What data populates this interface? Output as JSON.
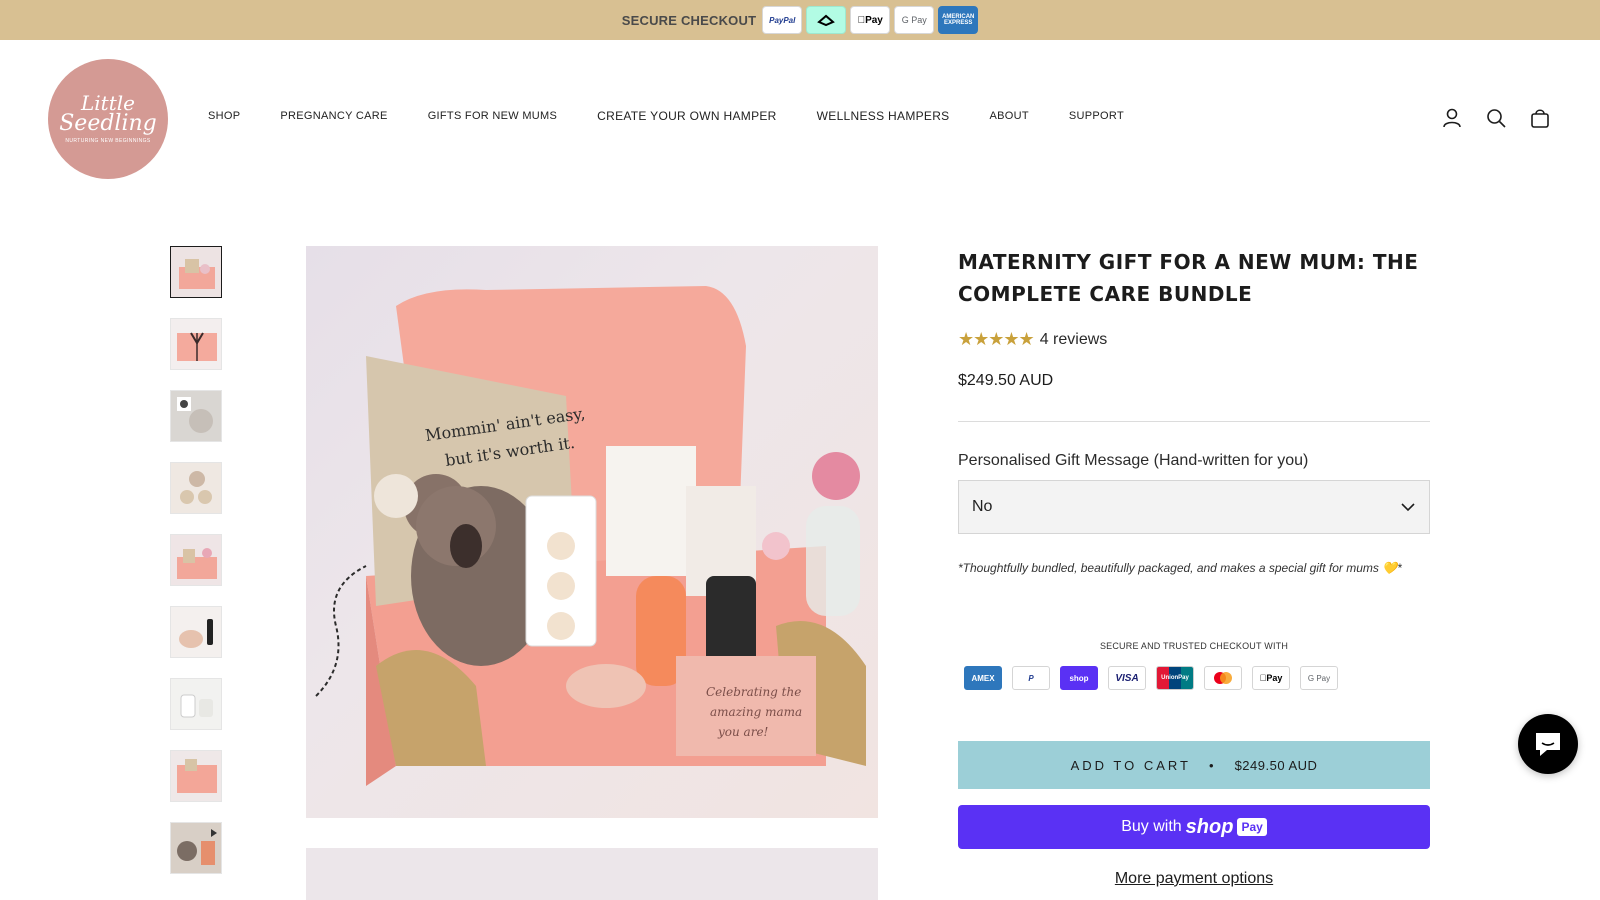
{
  "topbar": {
    "label": "SECURE CHECKOUT",
    "badges": [
      "PayPal",
      "afterpay",
      "Pay",
      "G Pay",
      "AMERICAN EXPRESS"
    ]
  },
  "logo": {
    "line1": "Little",
    "line2": "Seedling",
    "tagline": "NURTURING NEW BEGINNINGS"
  },
  "nav": {
    "items": [
      "SHOP",
      "PREGNANCY CARE",
      "GIFTS FOR NEW MUMS",
      "CREATE YOUR OWN HAMPER",
      "WELLNESS HAMPERS",
      "ABOUT",
      "SUPPORT"
    ]
  },
  "header_icons": [
    "account-icon",
    "search-icon",
    "cart-icon"
  ],
  "product": {
    "title": "MATERNITY GIFT FOR A NEW MUM: THE COMPLETE CARE BUNDLE",
    "rating": 5,
    "rating_stars": "★★★★★",
    "reviews_label": "4 reviews",
    "price": "$249.50 AUD",
    "option_label": "Personalised Gift Message (Hand-written for you)",
    "option_value": "No",
    "note": "*Thoughtfully bundled, beautifully packaged, and makes a special gift for mums 💛*",
    "secure_title": "SECURE AND TRUSTED CHECKOUT WITH",
    "payment_icons": [
      "AMEX",
      "P",
      "shop",
      "VISA",
      "UnionPay",
      "mastercard",
      "Pay",
      "G Pay"
    ],
    "add_to_cart_label": "ADD TO CART",
    "add_to_cart_sep": "•",
    "add_to_cart_price": "$249.50 AUD",
    "buy_with": "Buy with",
    "buy_shop": "shop",
    "buy_pay": "Pay",
    "more_payment": "More payment options"
  },
  "image_text": {
    "bag_line1": "Mommin' ain't easy,",
    "bag_line2": "but it's worth it.",
    "card_line1": "Celebrating the",
    "card_line2": "amazing mama",
    "card_line3": "you are!"
  },
  "thumbnails": 9,
  "colors": {
    "topbar": "#d8c092",
    "logo": "#d49a94",
    "add_to_cart": "#9ccfd7",
    "shop_pay": "#5a31f4",
    "star": "#c9a13b"
  }
}
